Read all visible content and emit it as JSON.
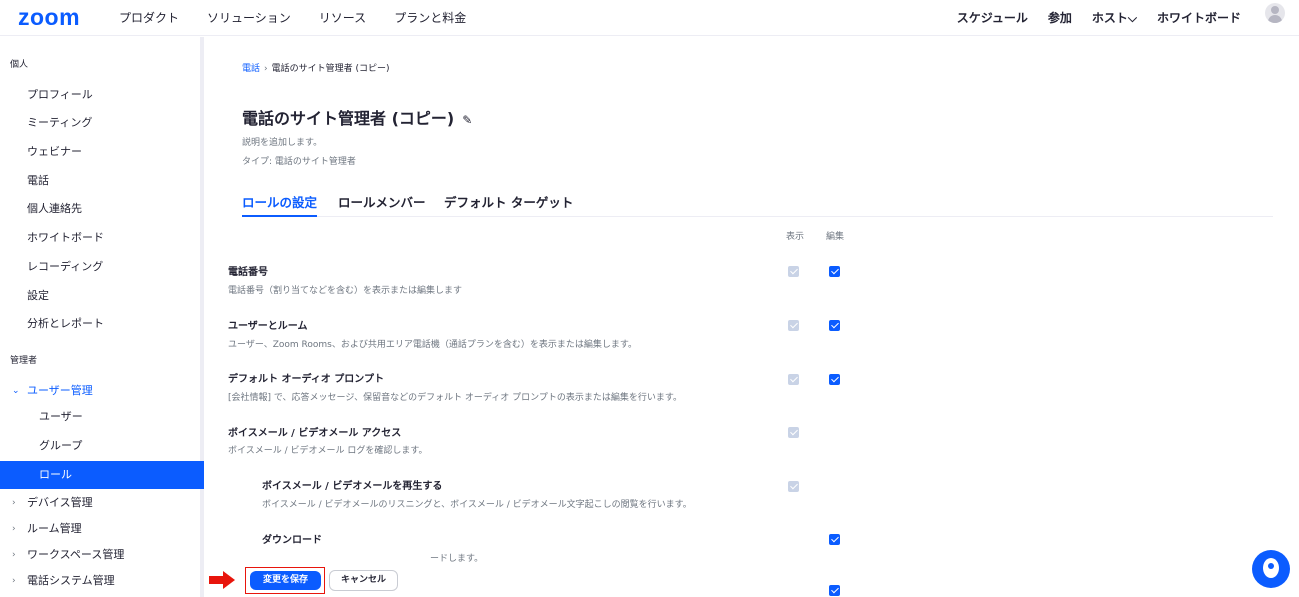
{
  "topnav": {
    "logo": "zoom",
    "left_items": [
      "プロダクト",
      "ソリューション",
      "リソース",
      "プランと料金"
    ],
    "right_items": [
      "スケジュール",
      "参加",
      "ホスト⌵",
      "ホワイトボード"
    ]
  },
  "sidebar": {
    "section_personal": "個人",
    "personal_items": [
      "プロフィール",
      "ミーティング",
      "ウェビナー",
      "電話",
      "個人連絡先",
      "ホワイトボード",
      "レコーディング",
      "設定",
      "分析とレポート"
    ],
    "section_admin": "管理者",
    "user_mgmt": "ユーザー管理",
    "user_mgmt_sub": [
      "ユーザー",
      "グループ",
      "ロール"
    ],
    "groups": [
      "デバイス管理",
      "ルーム管理",
      "ワークスペース管理",
      "電話システム管理"
    ]
  },
  "breadcrumb": {
    "link": "電話",
    "separator": "›",
    "current": "電話のサイト管理者 (コピー)"
  },
  "page": {
    "title": "電話のサイト管理者 (コピー)",
    "description": "説明を追加します。",
    "type": "タイプ: 電話のサイト管理者"
  },
  "tabs": [
    "ロールの設定",
    "ロールメンバー",
    "デフォルト ターゲット"
  ],
  "columns": {
    "view": "表示",
    "edit": "編集"
  },
  "permissions": [
    {
      "title": "電話番号",
      "desc": "電話番号（割り当てなどを含む）を表示または編集します",
      "view": "disabled-checked",
      "edit": "checked"
    },
    {
      "title": "ユーザーとルーム",
      "desc": "ユーザー、Zoom Rooms、および共用エリア電話機（通話プランを含む）を表示または編集します。",
      "view": "disabled-checked",
      "edit": "checked"
    },
    {
      "title": "デフォルト オーディオ プロンプト",
      "desc": "[会社情報] で、応答メッセージ、保留音などのデフォルト オーディオ プロンプトの表示または編集を行います。",
      "view": "disabled-checked",
      "edit": "checked"
    },
    {
      "title": "ボイスメール / ビデオメール アクセス",
      "desc": "ボイスメール / ビデオメール ログを確認します。",
      "view": "disabled-checked",
      "edit": "none"
    },
    {
      "title": "ボイスメール / ビデオメールを再生する",
      "desc": "ボイスメール / ビデオメールのリスニングと、ボイスメール / ビデオメール文字起こしの閲覧を行います。",
      "view": "disabled-checked",
      "edit": "none"
    },
    {
      "title": "ダウンロード",
      "desc": "ードします。",
      "view": "none",
      "edit": "checked"
    }
  ],
  "footer": {
    "save_label": "変更を保存",
    "cancel_label": "キャンセル"
  },
  "colors": {
    "accent": "#0b5cff",
    "annotation": "#e8150c"
  }
}
